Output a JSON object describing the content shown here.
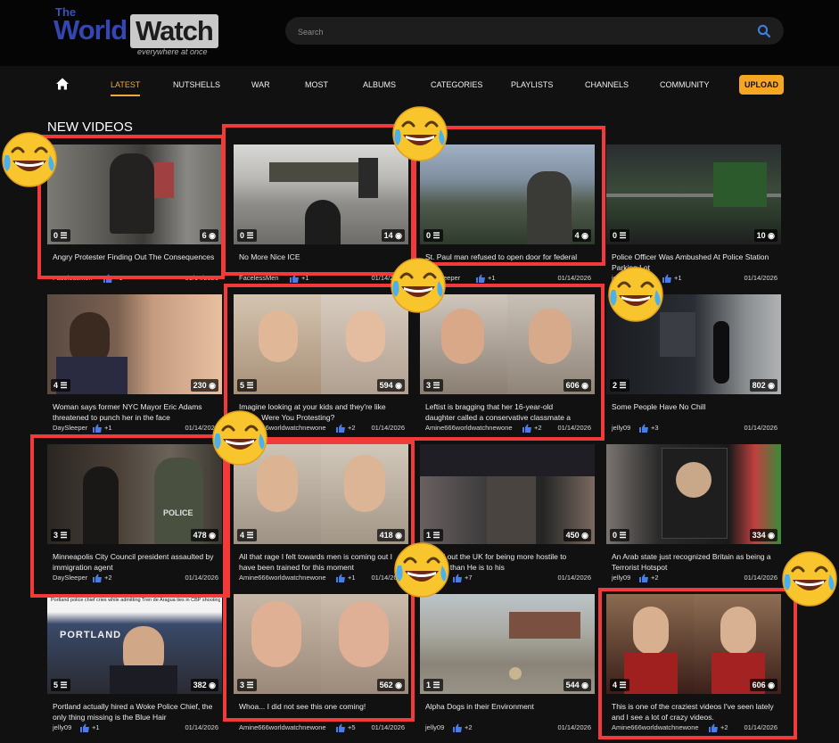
{
  "header": {
    "logo_the": "The",
    "logo_world": "World",
    "logo_watch": "Watch",
    "logo_tagline": "everywhere at once",
    "search_placeholder": "Search"
  },
  "nav": {
    "items": [
      "LATEST",
      "NUTSHELLS",
      "WAR",
      "MOST",
      "ALBUMS",
      "CATEGORIES",
      "PLAYLISTS",
      "CHANNELS",
      "COMMUNITY"
    ],
    "active": "LATEST",
    "upload_label": "UPLOAD"
  },
  "section_title": "NEW VIDEOS",
  "colors": {
    "accent": "#f3a73a",
    "upload": "#f5a623",
    "highlight": "#f23a3a",
    "like": "#4a7be8"
  },
  "videos": [
    {
      "title_lines": [
        "Angry Protester Finding Out The Consequences"
      ],
      "user": "FacelessMen",
      "likes": "+1",
      "date": "01/14/2026",
      "comments": "0",
      "views": "6"
    },
    {
      "title_lines": [
        "No More Nice ICE"
      ],
      "user": "FacelessMen",
      "likes": "+1",
      "date": "01/14/2026",
      "comments": "0",
      "views": "14"
    },
    {
      "title_lines": [
        "St. Paul man refused to open door for federal"
      ],
      "user": "DaySleeper",
      "likes": "+1",
      "date": "01/14/2026",
      "comments": "0",
      "views": "4"
    },
    {
      "title_lines": [
        "Police Officer Was Ambushed At Police Station",
        "Parking Lot"
      ],
      "user": "jelly09",
      "likes": "+1",
      "date": "01/14/2026",
      "comments": "0",
      "views": "10"
    },
    {
      "title_lines": [
        "Woman says former NYC Mayor Eric Adams",
        "threatened to punch her in the face"
      ],
      "user": "DaySleeper",
      "likes": "+1",
      "date": "01/14/2026",
      "comments": "4",
      "views": "230"
    },
    {
      "title_lines": [
        "Imagine looking at your kids and they're like",
        "'Mom, Were You Protesting?"
      ],
      "user": "Amine666worldwatchnewone",
      "likes": "+2",
      "date": "01/14/2026",
      "comments": "5",
      "views": "594"
    },
    {
      "title_lines": [
        "Leftist is bragging that her 16-year-old",
        "daughter called a conservative classmate a"
      ],
      "user": "Amine666worldwatchnewone",
      "likes": "+2",
      "date": "01/14/2026",
      "comments": "3",
      "views": "606"
    },
    {
      "title_lines": [
        "Some People Have No Chill"
      ],
      "user": "jelly09",
      "likes": "+3",
      "date": "01/14/2026",
      "comments": "2",
      "views": "802"
    },
    {
      "title_lines": [
        "Minneapolis City Council president assaulted by",
        "immigration agent"
      ],
      "user": "DaySleeper",
      "likes": "+2",
      "date": "01/14/2026",
      "comments": "3",
      "views": "478"
    },
    {
      "title_lines": [
        "All that rage I felt towards men is coming out I",
        "have been trained for this moment"
      ],
      "user": "Amine666worldwatchnewone",
      "likes": "+1",
      "date": "01/14/2026",
      "comments": "4",
      "views": "418"
    },
    {
      "title_lines": [
        "called out the UK for being more hostile to",
        "people than He is to his"
      ],
      "user": "jelly09",
      "likes": "+7",
      "date": "01/14/2026",
      "comments": "1",
      "views": "450"
    },
    {
      "title_lines": [
        "An Arab state just recognized Britain as being a",
        "Terrorist Hotspot"
      ],
      "user": "jelly09",
      "likes": "+2",
      "date": "01/14/2026",
      "comments": "0",
      "views": "334"
    },
    {
      "title_lines": [
        "Portland actually hired a Woke Police Chief, the",
        "only thing missing is the Blue Hair"
      ],
      "user": "jelly09",
      "likes": "+1",
      "date": "01/14/2026",
      "comments": "5",
      "views": "382"
    },
    {
      "title_lines": [
        "Whoa... I did not see this one coming!"
      ],
      "user": "Amine666worldwatchnewone",
      "likes": "+5",
      "date": "01/14/2026",
      "comments": "3",
      "views": "562"
    },
    {
      "title_lines": [
        "Alpha Dogs in their Environment"
      ],
      "user": "jelly09",
      "likes": "+2",
      "date": "01/14/2026",
      "comments": "1",
      "views": "544"
    },
    {
      "title_lines": [
        "This is one of the craziest videos I've seen lately",
        "and I see a lot of crazy videos."
      ],
      "user": "Amine666worldwatchnewone",
      "likes": "+2",
      "date": "01/14/2026",
      "comments": "4",
      "views": "606"
    }
  ],
  "thumb_captions": {
    "portland_headline": "Portland police chief cries while admitting Tren de Aragua ties in CBP shooting.",
    "portland_sign": "PORTLAND",
    "police_vest": "POLICE"
  }
}
